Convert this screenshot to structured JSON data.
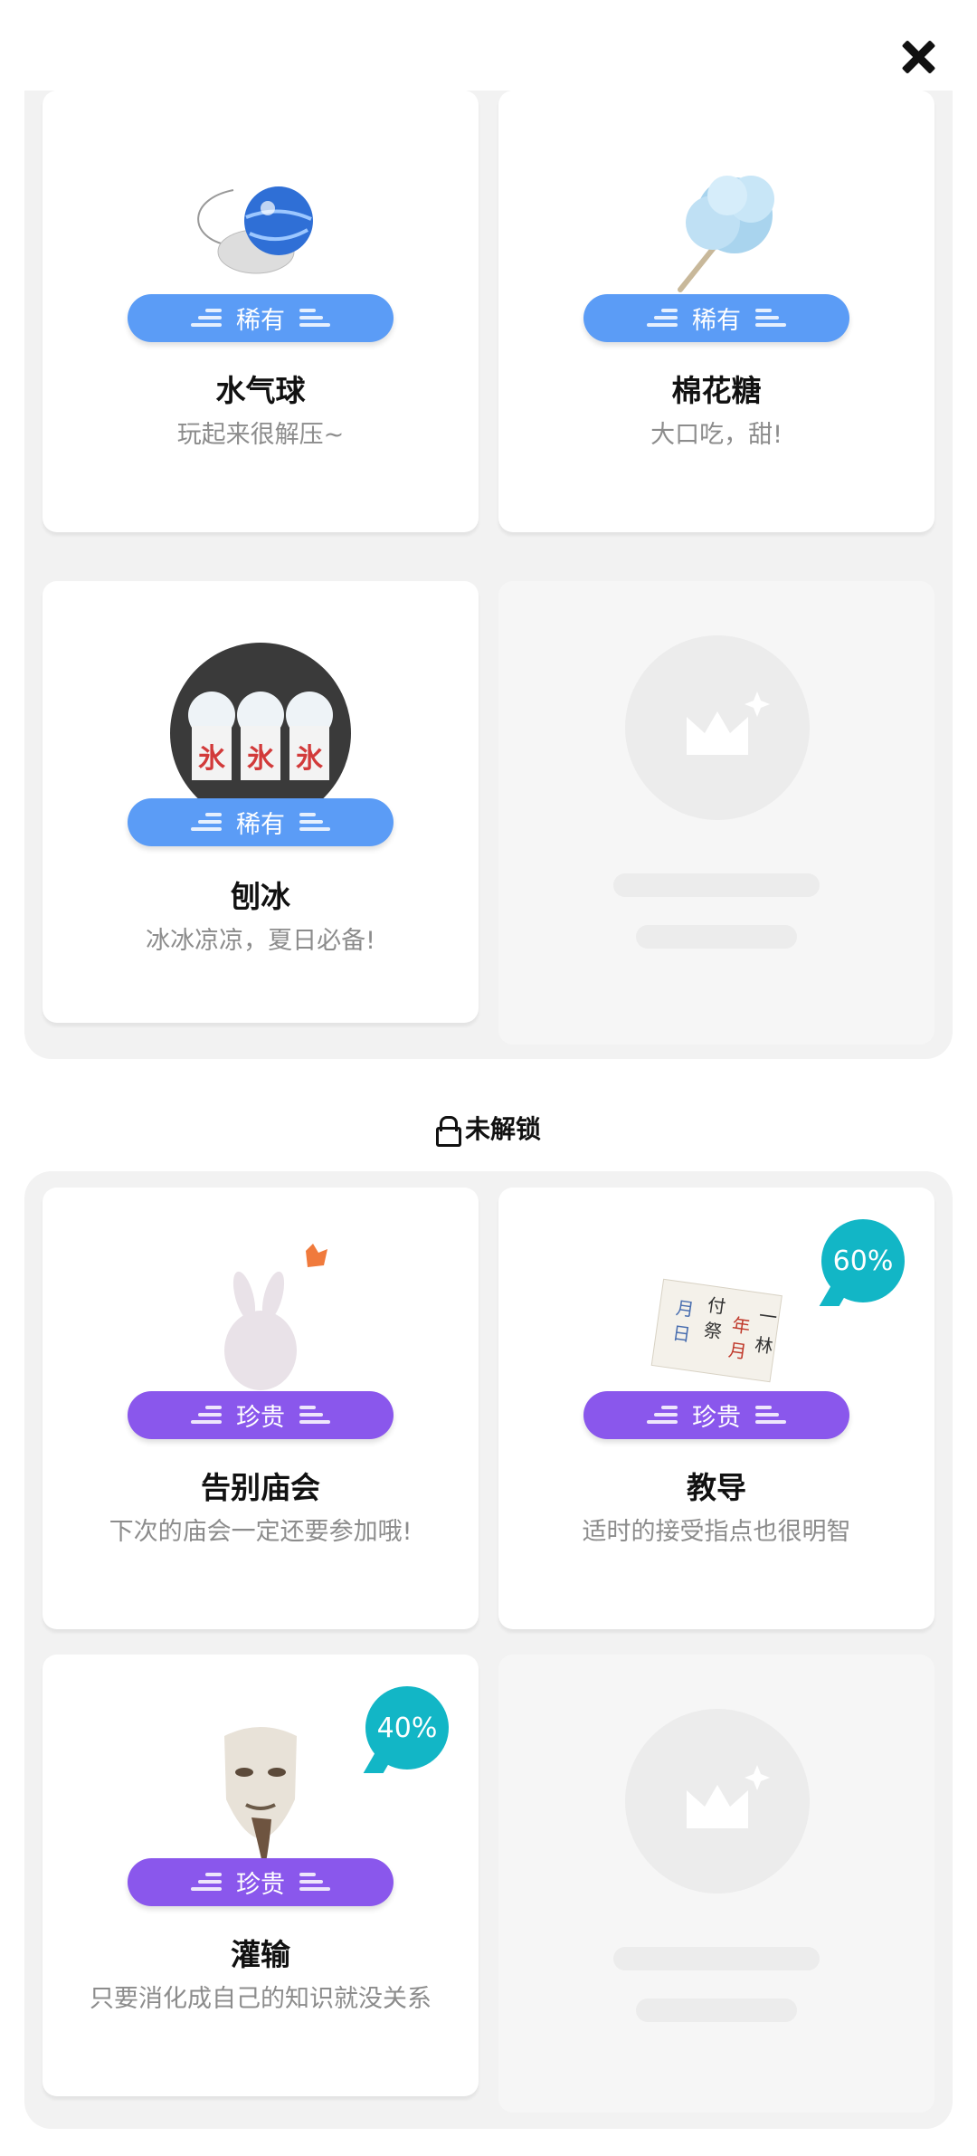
{
  "header": {
    "close_icon": "close-icon"
  },
  "unlocked": {
    "items": [
      {
        "title": "水气球",
        "description": "玩起来很解压~",
        "rarity": "稀有",
        "icon": "water-balloon-icon",
        "color": "#5b9cf6"
      },
      {
        "title": "棉花糖",
        "description": "大口吃，甜!",
        "rarity": "稀有",
        "icon": "cotton-candy-icon",
        "color": "#5b9cf6"
      },
      {
        "title": "刨冰",
        "description": "冰冰凉凉，夏日必备!",
        "rarity": "稀有",
        "icon": "shaved-ice-icon",
        "color": "#5b9cf6"
      }
    ]
  },
  "locked_section": {
    "label": "未解锁",
    "icon": "lock-icon"
  },
  "locked": {
    "items": [
      {
        "title": "告别庙会",
        "description": "下次的庙会一定还要参加哦!",
        "rarity": "珍贵",
        "icon": "rabbit-icon",
        "color": "#8a57ec"
      },
      {
        "title": "教导",
        "description": "适时的接受指点也很明智",
        "rarity": "珍贵",
        "icon": "paper-note-icon",
        "color": "#8a57ec",
        "progress": "60%"
      },
      {
        "title": "灌输",
        "description": "只要消化成自己的知识就没关系",
        "rarity": "珍贵",
        "icon": "mask-icon",
        "color": "#8a57ec",
        "progress": "40%"
      }
    ]
  }
}
